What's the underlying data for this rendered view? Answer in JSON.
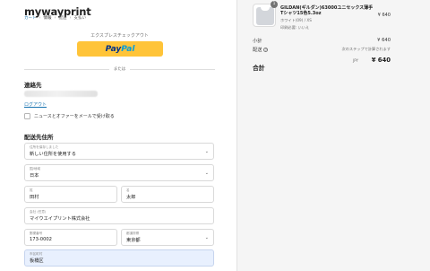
{
  "store": {
    "name": "mywayprint"
  },
  "breadcrumb": {
    "items": [
      "カート",
      "情報",
      "配送",
      "支払い"
    ],
    "separator": "›"
  },
  "express": {
    "label": "エクスプレスチェックアウト",
    "paypal_prefix": "Pay",
    "paypal_suffix": "Pal"
  },
  "divider": {
    "label": "または"
  },
  "contact": {
    "title": "連絡先",
    "logout_link": "ログアウト",
    "newsletter_label": "ニュースとオファーをメールで受け取る",
    "newsletter_checked": false
  },
  "shipping": {
    "title": "配送先住所",
    "saved_address": {
      "label": "住所を保存しました",
      "value": "新しい住所を使用する"
    },
    "country": {
      "label": "国/地域",
      "value": "日本"
    },
    "last_name": {
      "label": "姓",
      "value": "田村"
    },
    "first_name": {
      "label": "名",
      "value": "太郎"
    },
    "company": {
      "label": "会社 (任意)",
      "value": "マイウエイプリント株式会社"
    },
    "postal_code": {
      "label": "郵便番号",
      "value": "173-0002"
    },
    "prefecture": {
      "label": "都道府県",
      "value": "東京都"
    },
    "city": {
      "label": "市区町村",
      "value": "板橋区"
    }
  },
  "order": {
    "item": {
      "quantity": "1",
      "name": "GILDAN(ギルダン)63000ユニセックス薄手Tシャツ15色5.3oz",
      "variant": "ホワイト(09) / XS",
      "stock": "印刷必要: いいえ",
      "price": "¥ 640"
    },
    "subtotal_label": "小計",
    "subtotal_value": "¥ 640",
    "shipping_label": "配送",
    "shipping_value": "次のステップで計算されます",
    "total_label": "合計",
    "currency": "JPY",
    "total_value": "¥ 640"
  },
  "icons": {
    "info": "info-icon",
    "chevron": "chevron-down-icon",
    "product": "tshirt-thumbnail-icon"
  },
  "colors": {
    "paypal_yellow": "#ffc439",
    "link_blue": "#1773b0",
    "autofill_blue": "#e8f0fe",
    "summary_bg": "#f5f5f5"
  }
}
